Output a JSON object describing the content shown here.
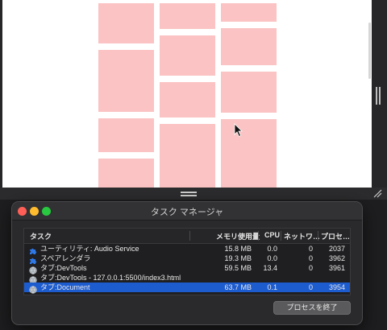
{
  "window": {
    "title": "タスク マネージャ"
  },
  "colors": {
    "tile": "#fbc3c3",
    "selection": "#1d5ccf",
    "close_light": "#ff5f57",
    "minimize_light": "#febc2e",
    "zoom_light": "#28c840"
  },
  "table": {
    "headers": {
      "task": "タスク",
      "memory": "メモリ使用量",
      "cpu": "CPU",
      "network": "ネットワ…",
      "process": "プロセ…"
    },
    "rows": [
      {
        "icon": "puzzle-icon",
        "task": "ユーティリティ: Audio Service",
        "memory": "15.8 MB",
        "cpu": "0.0",
        "network": "0",
        "pid": "2037",
        "selected": false
      },
      {
        "icon": "puzzle-icon",
        "task": "スペアレンダラ",
        "memory": "19.3 MB",
        "cpu": "0.0",
        "network": "0",
        "pid": "3962",
        "selected": false
      },
      {
        "icon": "globe-icon",
        "task": "タブ:DevTools",
        "memory": "59.5 MB",
        "cpu": "13.4",
        "network": "0",
        "pid": "3961",
        "selected": false
      },
      {
        "icon": "globe-icon",
        "task": "タブ:DevTools - 127.0.0.1:5500/index3.html",
        "memory": "",
        "cpu": "",
        "network": "",
        "pid": "",
        "selected": false
      },
      {
        "icon": "globe-icon",
        "task": "タブ:Document",
        "memory": "63.7 MB",
        "cpu": "0.1",
        "network": "0",
        "pid": "3954",
        "selected": true
      }
    ]
  },
  "buttons": {
    "end_process": "プロセスを終了"
  }
}
